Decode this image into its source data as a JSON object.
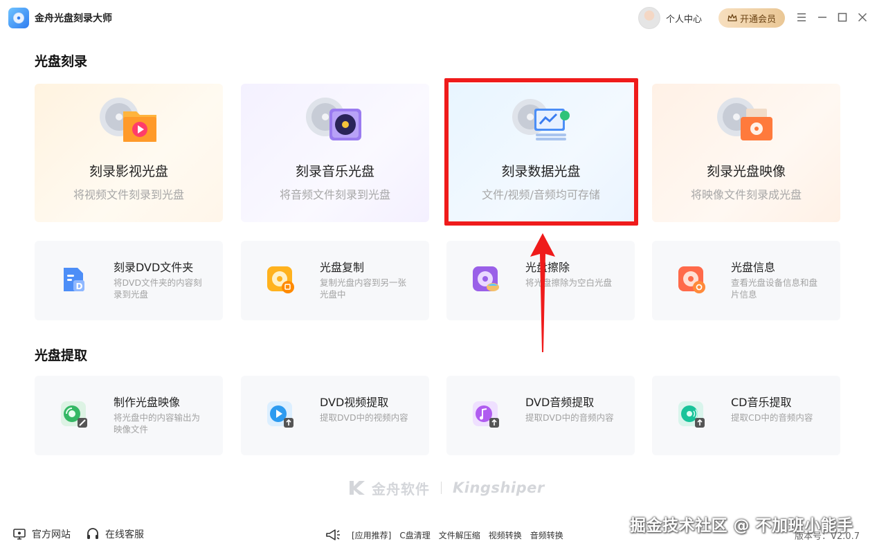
{
  "app": {
    "title": "金舟光盘刻录大师"
  },
  "header": {
    "user_center": "个人中心",
    "vip_button": "开通会员"
  },
  "sections": {
    "burn_title": "光盘刻录",
    "extract_title": "光盘提取"
  },
  "burn_cards": [
    {
      "title": "刻录影视光盘",
      "desc": "将视频文件刻录到光盘"
    },
    {
      "title": "刻录音乐光盘",
      "desc": "将音频文件刻录到光盘"
    },
    {
      "title": "刻录数据光盘",
      "desc": "文件/视频/音频均可存储"
    },
    {
      "title": "刻录光盘映像",
      "desc": "将映像文件刻录成光盘"
    }
  ],
  "tool_cards": [
    {
      "title": "刻录DVD文件夹",
      "desc": "将DVD文件夹的内容刻录到光盘"
    },
    {
      "title": "光盘复制",
      "desc": "复制光盘内容到另一张光盘中"
    },
    {
      "title": "光盘擦除",
      "desc": "将光盘擦除为空白光盘"
    },
    {
      "title": "光盘信息",
      "desc": "查看光盘设备信息和盘片信息"
    }
  ],
  "extract_cards": [
    {
      "title": "制作光盘映像",
      "desc": "将光盘中的内容输出为映像文件"
    },
    {
      "title": "DVD视频提取",
      "desc": "提取DVD中的视频内容"
    },
    {
      "title": "DVD音频提取",
      "desc": "提取DVD中的音频内容"
    },
    {
      "title": "CD音乐提取",
      "desc": "提取CD中的音频内容"
    }
  ],
  "brand": {
    "cn": "金舟软件",
    "en": "Kingshiper"
  },
  "footer": {
    "website": "官方网站",
    "service": "在线客服",
    "recommend_label": "[应用推荐]",
    "recommend_items": [
      "C盘清理",
      "文件解压缩",
      "视频转换",
      "音频转换"
    ],
    "watermark": "掘金技术社区 @ 不加班小能手",
    "version": "版本号：V2.0.7"
  },
  "colors": {
    "highlight": "#ef1b1b",
    "vip_gold": "#eac795",
    "accent_blue": "#2e7cf0"
  }
}
